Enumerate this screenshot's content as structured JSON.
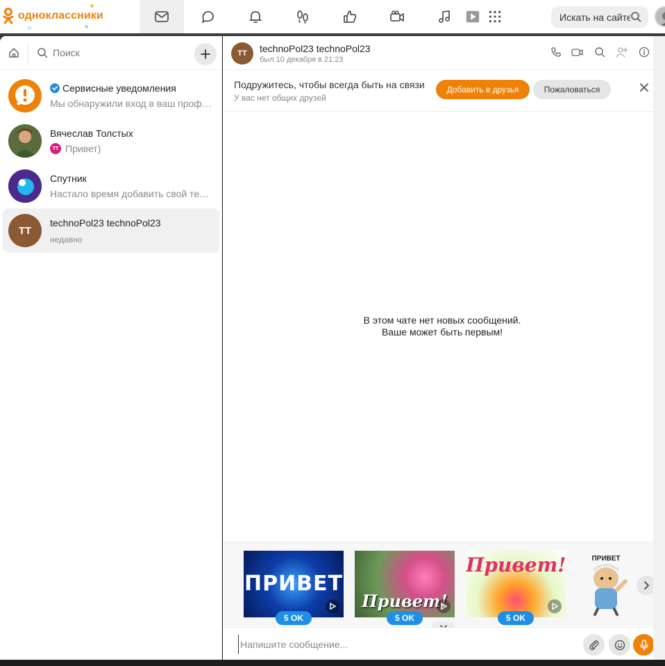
{
  "brand": {
    "name": "одноклассники",
    "accent": "#ee8208"
  },
  "nav": [
    {
      "id": "messages",
      "icon": "envelope-icon",
      "active": true
    },
    {
      "id": "discussions",
      "icon": "speech-bubbles-icon"
    },
    {
      "id": "notifications",
      "icon": "bell-icon"
    },
    {
      "id": "guests",
      "icon": "footprints-icon"
    },
    {
      "id": "events",
      "icon": "thumbs-up-icon"
    },
    {
      "id": "video",
      "icon": "video-camera-icon"
    },
    {
      "id": "music",
      "icon": "music-note-icon"
    },
    {
      "id": "games",
      "icon": "grid-icon"
    }
  ],
  "search": {
    "placeholder": "Искать на сайте"
  },
  "left": {
    "search_label": "Поиск",
    "chats": [
      {
        "name": "Сервисные уведомления",
        "preview": "Мы обнаружили вход в ваш профиль",
        "verified": true,
        "avatar": "alert-icon"
      },
      {
        "name": "Вячеслав Толстых",
        "preview": "Привет)",
        "preview_avatar": "ТТ"
      },
      {
        "name": "Спутник",
        "preview": "Настало время добавить свой телефон"
      },
      {
        "name": "technoPol23 technoPol23",
        "preview": "недавно",
        "initials": "ТТ",
        "selected": true
      }
    ]
  },
  "chat": {
    "title": "technoPol23 technoPol23",
    "initials": "ТТ",
    "status": "был 10 декабря в 21:23",
    "friend_bar": {
      "title": "Подружитесь, чтобы всегда быть на связи",
      "subtitle": "У вас нет общих друзей",
      "add_label": "Добавить в друзья",
      "report_label": "Пожаловаться"
    },
    "empty_line1": "В этом чате нет новых сообщений.",
    "empty_line2": "Ваше может быть первым!",
    "stickers": [
      {
        "text": "ПРИВЕТ",
        "price": "5 OK"
      },
      {
        "text": "Привет!",
        "price": "5 OK"
      },
      {
        "text": "Привет!",
        "price": "5 OK"
      },
      {
        "text": "ПРИВЕТ"
      }
    ],
    "input_placeholder": "Напишите сообщение..."
  }
}
